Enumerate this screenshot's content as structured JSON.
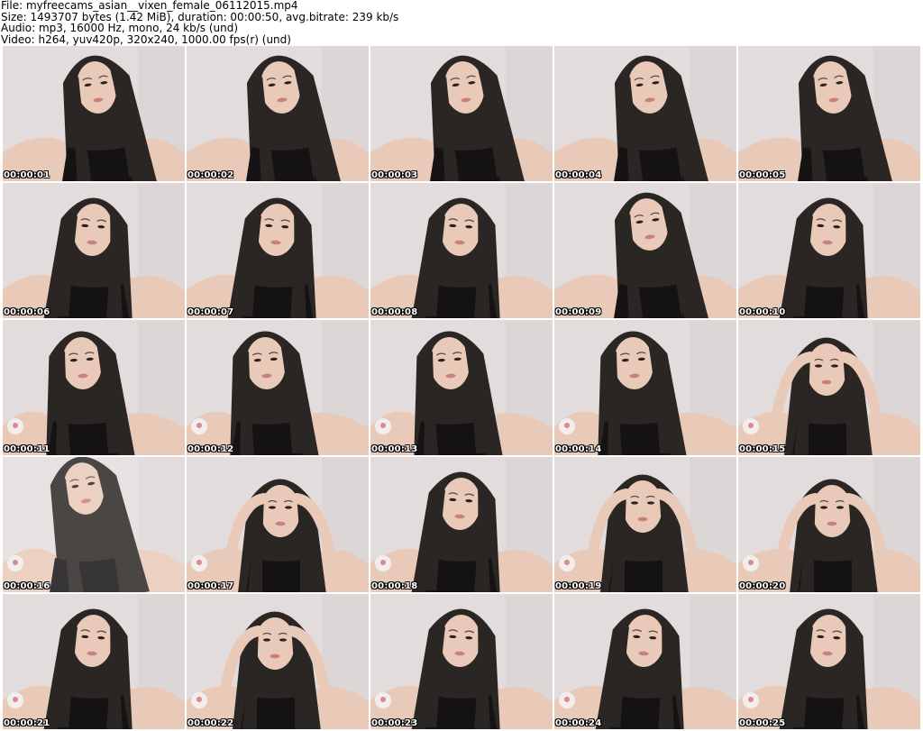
{
  "header": {
    "file_line": "File: myfreecams_asian__vixen_female_06112015.mp4",
    "size_line": "Size: 1493707 bytes (1.42 MiB), duration: 00:00:50, avg.bitrate: 239 kb/s",
    "audio_line": "Audio: mp3, 16000 Hz, mono, 24 kb/s (und)",
    "video_line": "Video: h264, yuv420p, 320x240, 1000.00 fps(r) (und)"
  },
  "colors": {
    "background": "#ffffff",
    "wall": "#e3dcdc",
    "hair": "#2a2624",
    "skin": "#e9c9b8",
    "top": "#141212"
  },
  "thumbnails": [
    {
      "timestamp": "00:00:01",
      "pose": "down"
    },
    {
      "timestamp": "00:00:02",
      "pose": "down"
    },
    {
      "timestamp": "00:00:03",
      "pose": "down"
    },
    {
      "timestamp": "00:00:04",
      "pose": "down"
    },
    {
      "timestamp": "00:00:05",
      "pose": "down"
    },
    {
      "timestamp": "00:00:06",
      "pose": "front"
    },
    {
      "timestamp": "00:00:07",
      "pose": "front"
    },
    {
      "timestamp": "00:00:08",
      "pose": "front"
    },
    {
      "timestamp": "00:00:09",
      "pose": "down"
    },
    {
      "timestamp": "00:00:10",
      "pose": "front"
    },
    {
      "timestamp": "00:00:11",
      "pose": "side"
    },
    {
      "timestamp": "00:00:12",
      "pose": "side"
    },
    {
      "timestamp": "00:00:13",
      "pose": "side"
    },
    {
      "timestamp": "00:00:14",
      "pose": "side"
    },
    {
      "timestamp": "00:00:15",
      "pose": "hands"
    },
    {
      "timestamp": "00:00:16",
      "pose": "blur"
    },
    {
      "timestamp": "00:00:17",
      "pose": "arms"
    },
    {
      "timestamp": "00:00:18",
      "pose": "front"
    },
    {
      "timestamp": "00:00:19",
      "pose": "hands"
    },
    {
      "timestamp": "00:00:20",
      "pose": "arms"
    },
    {
      "timestamp": "00:00:21",
      "pose": "front"
    },
    {
      "timestamp": "00:00:22",
      "pose": "hands"
    },
    {
      "timestamp": "00:00:23",
      "pose": "front"
    },
    {
      "timestamp": "00:00:24",
      "pose": "front"
    },
    {
      "timestamp": "00:00:25",
      "pose": "front"
    }
  ]
}
